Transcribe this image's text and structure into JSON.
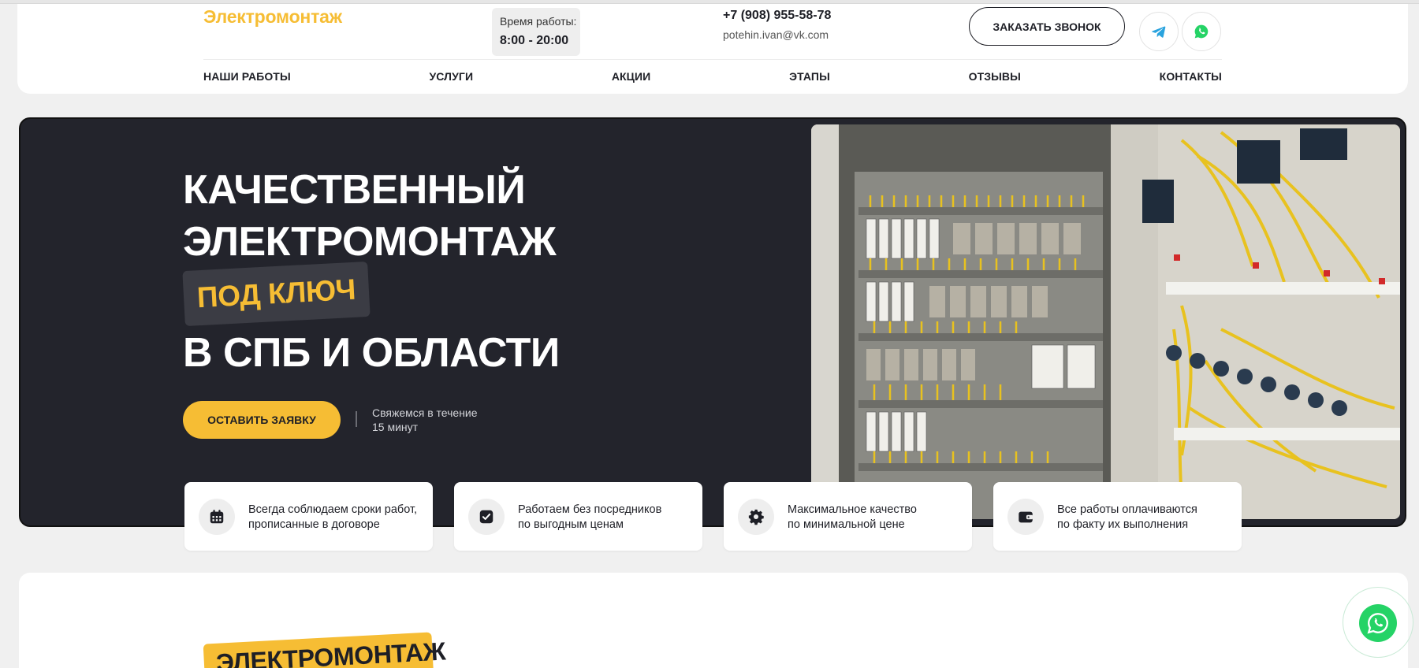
{
  "header": {
    "logo": "Электромонтаж",
    "hours_label": "Время работы:",
    "hours_value": "8:00 - 20:00",
    "phone": "+7 (908) 955-58-78",
    "email": "potehin.ivan@vk.com",
    "call_button": "ЗАКАЗАТЬ ЗВОНОК",
    "social_icons": [
      "telegram-icon",
      "whatsapp-icon"
    ]
  },
  "nav": {
    "items": [
      "НАШИ РАБОТЫ",
      "УСЛУГИ",
      "АКЦИИ",
      "ЭТАПЫ",
      "ОТЗЫВЫ",
      "КОНТАКТЫ"
    ]
  },
  "hero": {
    "line1": "КАЧЕСТВЕННЫЙ",
    "line2": "ЭЛЕКТРОМОНТАЖ",
    "tag": "ПОД КЛЮЧ",
    "line4": "В СПБ И ОБЛАСТИ",
    "order_button": "ОСТАВИТЬ ЗАЯВКУ",
    "note_line1": "Свяжемся в течение",
    "note_line2": "15 минут"
  },
  "features": [
    {
      "icon": "calendar-icon",
      "line1": "Всегда соблюдаем сроки работ,",
      "line2": "прописанные в договоре"
    },
    {
      "icon": "check-square-icon",
      "line1": "Работаем без посредников",
      "line2": "по выгодным ценам"
    },
    {
      "icon": "gear-icon",
      "line1": "Максимальное качество",
      "line2": "по минимальной цене"
    },
    {
      "icon": "wallet-icon",
      "line1": "Все работы оплачиваются",
      "line2": "по факту их выполнения"
    }
  ],
  "section2": {
    "title": "ЭЛЕКТРОМОНТАЖ"
  },
  "colors": {
    "accent": "#f6bd34",
    "dark": "#23242c",
    "whatsapp": "#25d366",
    "telegram": "#2aa3de"
  }
}
